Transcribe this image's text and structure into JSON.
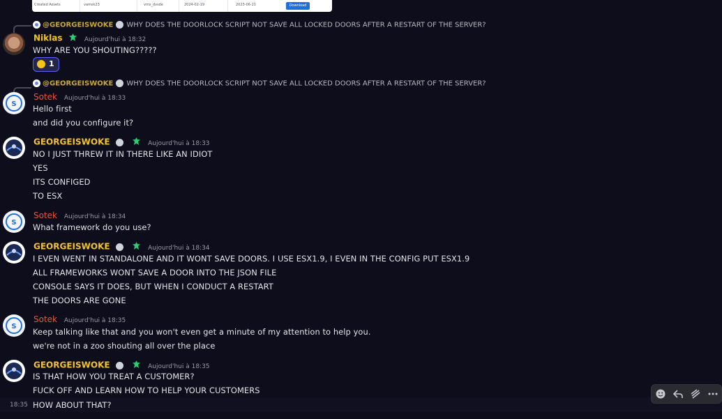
{
  "top_image": {
    "cells": [
      "Created Assets",
      "vamsk23",
      "vms_dvsde",
      "2024-02-19",
      "2023-06-21"
    ],
    "download_label": "Download"
  },
  "reply_text": "WHY DOES THE DOORLOCK SCRIPT NOT SAVE ALL LOCKED DOORS AFTER A RESTART OF THE SERVER?",
  "reply_mention": "@GEORGEISWOKE",
  "messages": [
    {
      "author": "Niklas",
      "time": "Aujourd'hui à 18:32",
      "lines": [
        "WHY ARE YOU SHOUTING?????"
      ],
      "reaction_count": "1"
    },
    {
      "author": "Sotek",
      "time": "Aujourd'hui à 18:33",
      "lines": [
        "Hello first",
        "and did you configure it?"
      ]
    },
    {
      "author": "GEORGEISWOKE",
      "time": "Aujourd'hui à 18:33",
      "lines": [
        "NO I JUST THREW IT IN THERE LIKE AN IDIOT",
        "YES",
        "ITS CONFIGED",
        "TO ESX"
      ]
    },
    {
      "author": "Sotek",
      "time": "Aujourd'hui à 18:34",
      "lines": [
        "What framework do you use?"
      ]
    },
    {
      "author": "GEORGEISWOKE",
      "time": "Aujourd'hui à 18:34",
      "lines": [
        "I EVEN WENT IN STANDALONE AND IT WONT SAVE DOORS. I USE ESX1.9, I EVEN IN THE CONFIG PUT ESX1.9",
        "ALL FRAMEWORKS WONT SAVE A DOOR INTO THE JSON FILE",
        "CONSOLE SAYS IT DOES, BUT WHEN I CONDUCT A RESTART",
        "THE DOORS ARE GONE"
      ]
    },
    {
      "author": "Sotek",
      "time": "Aujourd'hui à 18:35",
      "lines": [
        "Keep talking like that and you won't even get a minute of my attention to help you.",
        "we're not in a zoo shouting all over the place"
      ]
    },
    {
      "author": "GEORGEISWOKE",
      "time": "Aujourd'hui à 18:35",
      "lines": [
        "IS THAT HOW YOU TREAT A CUSTOMER?",
        "FUCK OFF AND LEARN HOW TO HELP YOUR CUSTOMERS",
        "HOW ABOUT THAT?"
      ]
    }
  ],
  "hover_time": "18:35",
  "toolbar": {
    "icons": [
      "add-reaction",
      "reply",
      "create-thread",
      "more"
    ]
  },
  "colors": {
    "niklas": "#f1c40f",
    "sotek": "#e8573b",
    "george": "#f2c230",
    "badge": "#2ecc71"
  }
}
